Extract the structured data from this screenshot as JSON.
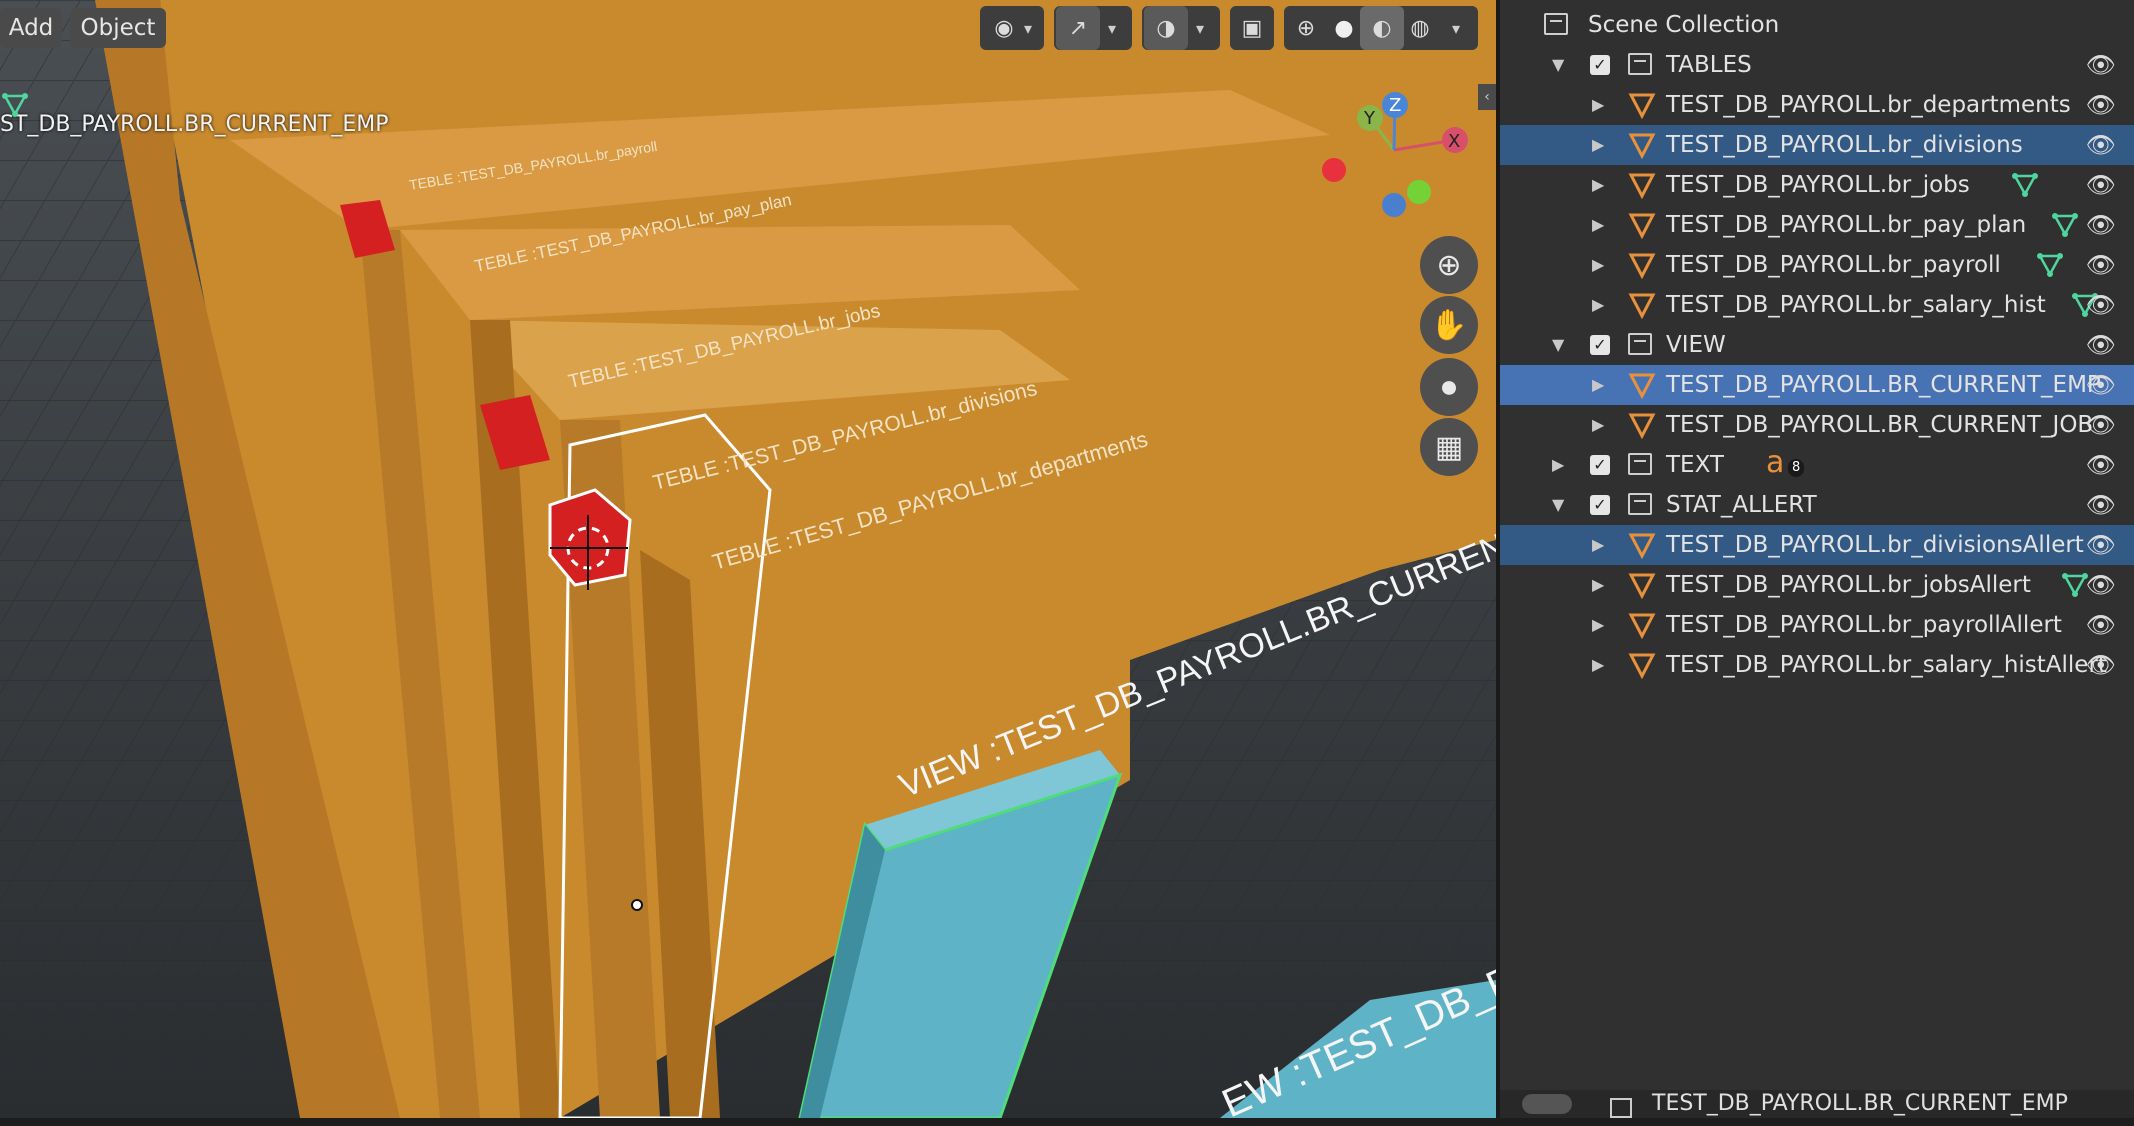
{
  "viewport": {
    "header": {
      "add_label": "Add",
      "object_label": "Object"
    },
    "overlay_label": "ST_DB_PAYROLL.BR_CURRENT_EMP",
    "nav_gizmo": {
      "x_label": "X",
      "y_label": "Y",
      "z_label": "Z"
    },
    "scene_texts": {
      "t_payroll": "TEBLE :TEST_DB_PAYROLL.br_payroll",
      "t_payplan": "TEBLE :TEST_DB_PAYROLL.br_pay_plan",
      "t_jobs": "TEBLE :TEST_DB_PAYROLL.br_jobs",
      "t_divisions": "TEBLE :TEST_DB_PAYROLL.br_divisions",
      "t_departments": "TEBLE :TEST_DB_PAYROLL.br_departments",
      "view_current_emp": "VIEW :TEST_DB_PAYROLL.BR_CURRENT_EMP",
      "view_partial": "EW :TEST_DB_PA"
    },
    "icons": [
      "view-visibility-icon",
      "gizmo-icon",
      "overlay-icon",
      "xray-icon",
      "wireframe-shading-icon",
      "solid-shading-icon",
      "material-shading-icon",
      "rendered-shading-icon",
      "zoom-icon",
      "pan-hand-icon",
      "camera-icon",
      "grid-ortho-icon"
    ]
  },
  "outliner": {
    "scene_collection": "Scene Collection",
    "rows": [
      {
        "label": "TABLES",
        "type": "collection",
        "expanded": true,
        "checked": true
      },
      {
        "label": "TEST_DB_PAYROLL.br_departments",
        "type": "mesh"
      },
      {
        "label": "TEST_DB_PAYROLL.br_divisions",
        "type": "mesh",
        "selected": true
      },
      {
        "label": "TEST_DB_PAYROLL.br_jobs",
        "type": "mesh"
      },
      {
        "label": "TEST_DB_PAYROLL.br_pay_plan",
        "type": "mesh"
      },
      {
        "label": "TEST_DB_PAYROLL.br_payroll",
        "type": "mesh"
      },
      {
        "label": "TEST_DB_PAYROLL.br_salary_hist",
        "type": "mesh"
      },
      {
        "label": "VIEW",
        "type": "collection",
        "expanded": true,
        "checked": true
      },
      {
        "label": "TEST_DB_PAYROLL.BR_CURRENT_EMP",
        "type": "mesh",
        "active": true
      },
      {
        "label": "TEST_DB_PAYROLL.BR_CURRENT_JOB",
        "type": "mesh"
      },
      {
        "label": "TEXT",
        "type": "collection",
        "expanded": false,
        "checked": true,
        "badge": "8"
      },
      {
        "label": "STAT_ALLERT",
        "type": "collection",
        "expanded": true,
        "checked": true
      },
      {
        "label": "TEST_DB_PAYROLL.br_divisionsAllert",
        "type": "mesh",
        "selected": true
      },
      {
        "label": "TEST_DB_PAYROLL.br_jobsAllert",
        "type": "mesh"
      },
      {
        "label": "TEST_DB_PAYROLL.br_payrollAllert",
        "type": "mesh"
      },
      {
        "label": "TEST_DB_PAYROLL.br_salary_histAllert",
        "type": "mesh"
      }
    ],
    "footer_label": "TEST_DB_PAYROLL.BR_CURRENT_EMP"
  },
  "colors": {
    "orange": "#c98a2e",
    "selected_row": "#335a85",
    "active_row": "#4772b3",
    "cyan": "#5fb3c6",
    "red": "#d42020"
  }
}
